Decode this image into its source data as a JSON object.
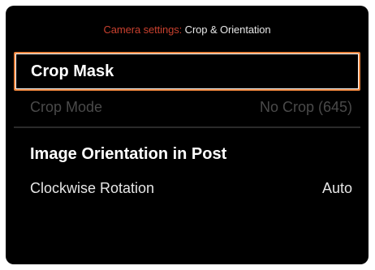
{
  "header": {
    "prefix": "Camera settings:",
    "title": "Crop & Orientation"
  },
  "crop_mask": {
    "label": "Crop Mask",
    "selected": true
  },
  "crop_mode": {
    "label": "Crop Mode",
    "value": "No Crop (645)",
    "enabled": false
  },
  "orientation": {
    "heading": "Image Orientation in Post"
  },
  "rotation": {
    "label": "Clockwise Rotation",
    "value": "Auto"
  },
  "colors": {
    "accent": "#c8402e",
    "selection_border": "#e8823c",
    "background": "#000000"
  }
}
